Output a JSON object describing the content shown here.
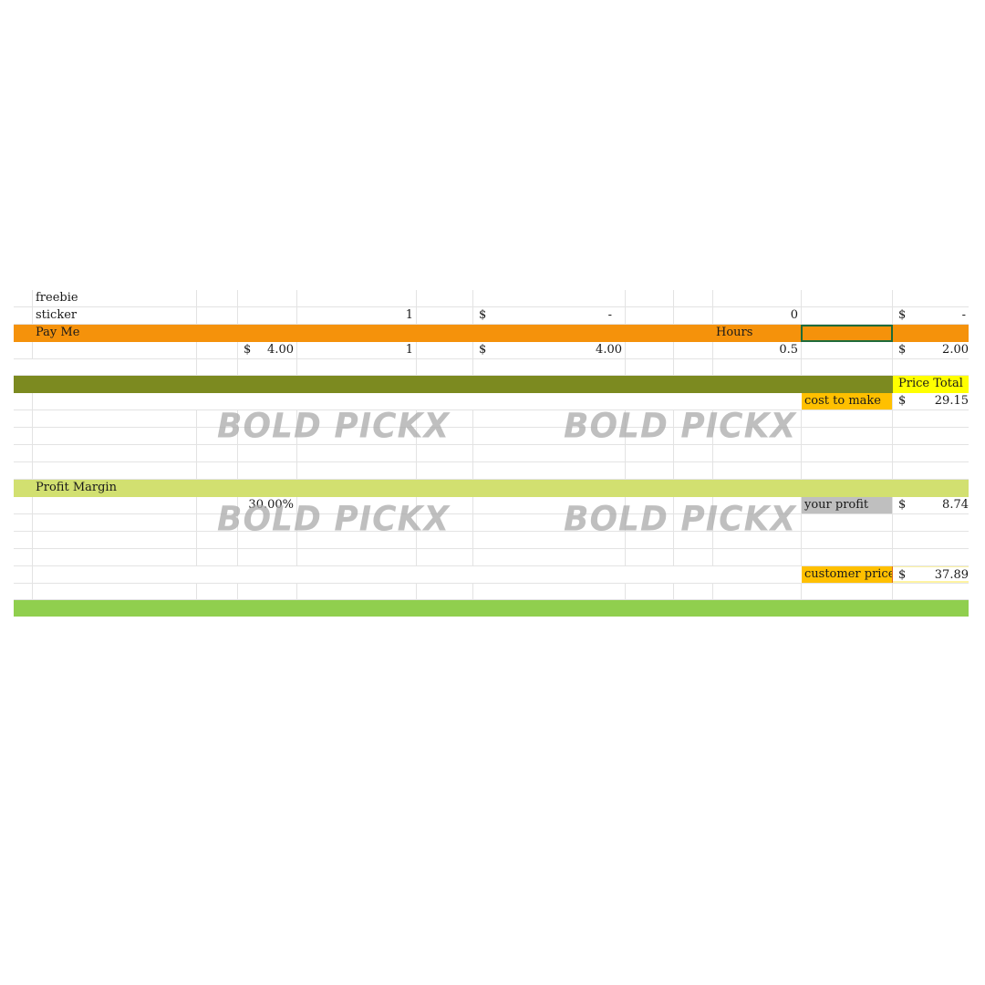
{
  "rows": {
    "freebie": {
      "label": "freebie"
    },
    "sticker": {
      "label": "sticker",
      "qty": "1",
      "cost_symbol": "$",
      "cost_value": "-",
      "hours": "0",
      "total_symbol": "$",
      "total_value": "-"
    },
    "pay_me_header": {
      "label": "Pay Me",
      "hours_label": "Hours"
    },
    "pay_me": {
      "rate_symbol": "$",
      "rate_value": "4.00",
      "qty": "1",
      "cost_symbol": "$",
      "cost_value": "4.00",
      "hours": "0.5",
      "total_symbol": "$",
      "total_value": "2.00"
    },
    "price_total_header": {
      "label": "Price Total"
    },
    "cost_to_make": {
      "label": "cost to make",
      "symbol": "$",
      "value": "29.15"
    },
    "profit_margin_header": {
      "label": "Profit Margin"
    },
    "profit_margin": {
      "value": "30.00%"
    },
    "your_profit": {
      "label": "your profit",
      "symbol": "$",
      "value": "8.74"
    },
    "customer_price": {
      "label": "customer price",
      "symbol": "$",
      "value": "37.89"
    }
  },
  "watermark": {
    "text": "BOLD PICKX"
  },
  "colors": {
    "pay_me_band": "#f5920b",
    "price_total_band": "#7c8a20",
    "profit_margin_band": "#d2e070",
    "footer_band": "#90cf4e",
    "price_total_label": "#ffff00",
    "cost_to_make_label": "#ffc000",
    "your_profit_label": "#bfbfbf",
    "customer_price_label": "#ffc000"
  }
}
